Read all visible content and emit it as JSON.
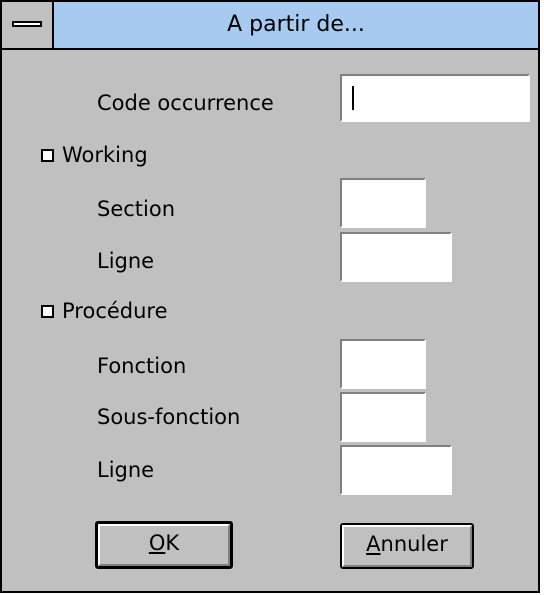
{
  "window": {
    "title": "A partir de..."
  },
  "form": {
    "code_occurrence_label": "Code occurrence",
    "code_occurrence_value": "",
    "working_label": "Working",
    "working_checked": false,
    "section_label": "Section",
    "working_ligne_label": "Ligne",
    "procedure_label": "Procédure",
    "procedure_checked": false,
    "fonction_label": "Fonction",
    "sous_fonction_label": "Sous-fonction",
    "procedure_ligne_label": "Ligne"
  },
  "buttons": {
    "ok_mnemonic": "O",
    "ok_rest": "K",
    "cancel_mnemonic": "A",
    "cancel_rest": "nnuler"
  },
  "colors": {
    "titlebar": "#a6caf0",
    "dialog_bg": "#c0c0c0"
  }
}
